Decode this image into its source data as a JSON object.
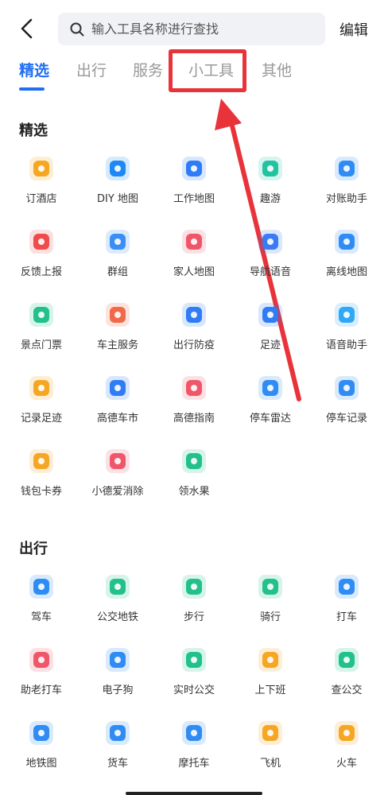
{
  "header": {
    "search_placeholder": "输入工具名称进行查找",
    "edit_label": "编辑"
  },
  "tabs": [
    {
      "label": "精选",
      "active": true
    },
    {
      "label": "出行",
      "active": false
    },
    {
      "label": "服务",
      "active": false
    },
    {
      "label": "小工具",
      "active": false
    },
    {
      "label": "其他",
      "active": false
    }
  ],
  "sections": [
    {
      "title": "精选",
      "items": [
        {
          "label": "订酒店",
          "icon": "hotel-icon",
          "color": "#f5a623"
        },
        {
          "label": "DIY 地图",
          "icon": "diy-map-icon",
          "color": "#1e88f5"
        },
        {
          "label": "工作地图",
          "icon": "work-map-icon",
          "color": "#2e7cf6"
        },
        {
          "label": "趣游",
          "icon": "fun-trip-icon",
          "color": "#22c3a0"
        },
        {
          "label": "对账助手",
          "icon": "etc-icon",
          "color": "#2f8cf5"
        },
        {
          "label": "反馈上报",
          "icon": "feedback-icon",
          "color": "#f04b4b"
        },
        {
          "label": "群组",
          "icon": "group-icon",
          "color": "#3a8ef6"
        },
        {
          "label": "家人地图",
          "icon": "family-map-icon",
          "color": "#f0566a"
        },
        {
          "label": "导航语音",
          "icon": "nav-voice-icon",
          "color": "#3a7af5"
        },
        {
          "label": "离线地图",
          "icon": "offline-map-icon",
          "color": "#2f8cf5"
        },
        {
          "label": "景点门票",
          "icon": "scenic-ticket-icon",
          "color": "#22c08a"
        },
        {
          "label": "车主服务",
          "icon": "car-owner-icon",
          "color": "#f06a4a"
        },
        {
          "label": "出行防疫",
          "icon": "epidemic-icon",
          "color": "#2f7cf5"
        },
        {
          "label": "足迹",
          "icon": "footprint-icon",
          "color": "#2f7cf5"
        },
        {
          "label": "语音助手",
          "icon": "voice-assistant-icon",
          "color": "#2fa8f5"
        },
        {
          "label": "记录足迹",
          "icon": "record-footprint-icon",
          "color": "#f5a623"
        },
        {
          "label": "高德车市",
          "icon": "car-market-icon",
          "color": "#2f7cf5"
        },
        {
          "label": "高德指南",
          "icon": "guide-icon",
          "color": "#f0566a"
        },
        {
          "label": "停车雷达",
          "icon": "parking-radar-icon",
          "color": "#2f8cf5"
        },
        {
          "label": "停车记录",
          "icon": "parking-record-icon",
          "color": "#2f8cf5"
        },
        {
          "label": "钱包卡券",
          "icon": "wallet-icon",
          "color": "#f5a623"
        },
        {
          "label": "小德爱消除",
          "icon": "game-icon",
          "color": "#f0566a"
        },
        {
          "label": "领水果",
          "icon": "fruit-tree-icon",
          "color": "#22c08a"
        }
      ]
    },
    {
      "title": "出行",
      "items": [
        {
          "label": "驾车",
          "icon": "car-icon",
          "color": "#2f8cf5"
        },
        {
          "label": "公交地铁",
          "icon": "bus-icon",
          "color": "#22c08a"
        },
        {
          "label": "步行",
          "icon": "walk-icon",
          "color": "#22c08a"
        },
        {
          "label": "骑行",
          "icon": "bike-icon",
          "color": "#22c08a"
        },
        {
          "label": "打车",
          "icon": "taxi-icon",
          "color": "#2f8cf5"
        },
        {
          "label": "助老打车",
          "icon": "elderly-taxi-icon",
          "color": "#f0566a"
        },
        {
          "label": "电子狗",
          "icon": "camera-icon",
          "color": "#2f8cf5"
        },
        {
          "label": "实时公交",
          "icon": "realtime-bus-icon",
          "color": "#22c08a"
        },
        {
          "label": "上下班",
          "icon": "commute-icon",
          "color": "#f5a623"
        },
        {
          "label": "查公交",
          "icon": "search-bus-icon",
          "color": "#22c08a"
        },
        {
          "label": "地铁图",
          "icon": "metro-map-icon",
          "color": "#2f8cf5"
        },
        {
          "label": "货车",
          "icon": "truck-icon",
          "color": "#2f8cf5"
        },
        {
          "label": "摩托车",
          "icon": "motorcycle-icon",
          "color": "#2f8cf5"
        },
        {
          "label": "飞机",
          "icon": "plane-icon",
          "color": "#f5a623"
        },
        {
          "label": "火车",
          "icon": "train-icon",
          "color": "#f5a623"
        }
      ]
    }
  ]
}
